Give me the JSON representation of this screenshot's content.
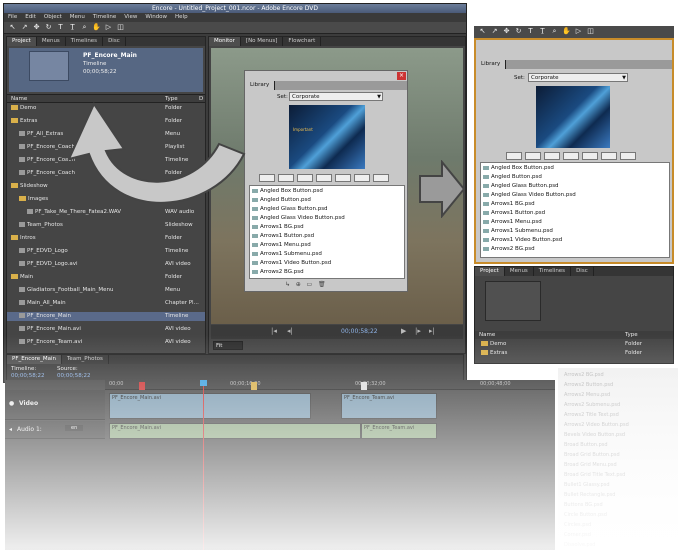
{
  "window": {
    "title": "Encore - Untitled_Project_001.ncor - Adobe Encore DVD"
  },
  "menu": [
    "File",
    "Edit",
    "Object",
    "Menu",
    "Timeline",
    "View",
    "Window",
    "Help"
  ],
  "tools": [
    "select-tool",
    "direct-select-tool",
    "move-tool",
    "rotate-tool",
    "text-tool",
    "vertical-text-tool",
    "zoom-tool",
    "hand-tool",
    "preview-tool",
    "edit-in-photoshop-tool"
  ],
  "project_panel": {
    "tabs": [
      "Project",
      "Menus",
      "Timelines",
      "Disc"
    ],
    "preview": {
      "name": "PF_Encore_Main",
      "kind": "Timeline",
      "duration": "00;00;58;22"
    },
    "columns": [
      "Name",
      "Type",
      "D"
    ],
    "items": [
      {
        "name": "Demo",
        "type": "Folder",
        "icon": "folder-icon"
      },
      {
        "name": "Extras",
        "type": "Folder",
        "icon": "folder-icon"
      },
      {
        "name": "PF_All_Extras",
        "type": "Menu",
        "icon": "file-icon"
      },
      {
        "name": "PF_Encore_Coach",
        "type": "Playlist",
        "icon": "file-icon"
      },
      {
        "name": "PF_Encore_Coach",
        "type": "Timeline",
        "icon": "file-icon"
      },
      {
        "name": "PF_Encore_Coach",
        "type": "Folder",
        "icon": "file-icon"
      },
      {
        "name": "Slideshow",
        "type": "Folder",
        "icon": "folder-icon"
      },
      {
        "name": "Images",
        "type": "Folder",
        "icon": "folder-icon"
      },
      {
        "name": "PF_Take_Me_There_Fatea2.WAV",
        "type": "WAV audio",
        "icon": "file-icon"
      },
      {
        "name": "Team_Photos",
        "type": "Slideshow",
        "icon": "file-icon"
      },
      {
        "name": "Intros",
        "type": "Folder",
        "icon": "folder-icon"
      },
      {
        "name": "PF_EDVD_Logo",
        "type": "Timeline",
        "icon": "file-icon"
      },
      {
        "name": "PF_EDVD_Logo.avi",
        "type": "AVI video",
        "icon": "file-icon"
      },
      {
        "name": "Main",
        "type": "Folder",
        "icon": "folder-icon"
      },
      {
        "name": "Gladiators_Football_Main_Menu",
        "type": "Menu",
        "icon": "file-icon"
      },
      {
        "name": "Main_All_Main",
        "type": "Chapter Pl...",
        "icon": "file-icon"
      },
      {
        "name": "PF_Encore_Main",
        "type": "Timeline",
        "icon": "file-icon"
      },
      {
        "name": "PF_Encore_Main.avi",
        "type": "AVI video",
        "icon": "file-icon"
      },
      {
        "name": "PF_Encore_Team.avi",
        "type": "AVI video",
        "icon": "file-icon"
      }
    ]
  },
  "monitor": {
    "tabs": [
      "Monitor",
      "[No Menus]",
      "Flowchart"
    ],
    "timecode": "00;00;58;22",
    "zoom": "Fit"
  },
  "library_floating": {
    "tab": "Library",
    "sort_label": "Set:",
    "sort_value": "Corporate",
    "thumb_text": "Important",
    "items": [
      "Angled Box Button.psd",
      "Angled Button.psd",
      "Angled Glass Button.psd",
      "Angled Glass Video Button.psd",
      "Arrows1 BG.psd",
      "Arrows1 Button.psd",
      "Arrows1 Menu.psd",
      "Arrows1 Submenu.psd",
      "Arrows1 Video Button.psd",
      "Arrows2 BG.psd"
    ]
  },
  "library_docked": {
    "tab": "Library",
    "sort_label": "Set:",
    "sort_value": "Corporate",
    "items": [
      "Angled Box Button.psd",
      "Angled Button.psd",
      "Angled Glass Button.psd",
      "Angled Glass Video Button.psd",
      "Arrows1 BG.psd",
      "Arrows1 Button.psd",
      "Arrows1 Menu.psd",
      "Arrows1 Submenu.psd",
      "Arrows1 Video Button.psd",
      "Arrows2 BG.psd"
    ]
  },
  "project_mini": {
    "tabs": [
      "Project",
      "Menus",
      "Timelines",
      "Disc"
    ],
    "columns": [
      "Name",
      "Type"
    ],
    "items": [
      {
        "name": "Demo",
        "type": "Folder"
      },
      {
        "name": "Extras",
        "type": "Folder"
      }
    ]
  },
  "timeline": {
    "tabs": [
      "PF_Encore_Main",
      "Team_Photos"
    ],
    "timeline_label": "Timeline:",
    "timeline_tc": "00;00;58;22",
    "source_label": "Source:",
    "source_tc": "00;00;58;22",
    "ruler": [
      "00;00",
      "00;00;16;00",
      "00;00;32;00",
      "00;00;48;00"
    ],
    "video_track": "Video",
    "audio_track": "Audio 1:",
    "audio_lang": "en",
    "video_clips": [
      "PF_Encore_Main.avi",
      "PF_Encore_Team.avi"
    ],
    "audio_clips": [
      "PF_Encore_Main.avi",
      "PF_Encore_Team.avi"
    ]
  },
  "ghost_list": [
    "Arrows2 BG.psd",
    "Arrows2 Button.psd",
    "Arrows2 Menu.psd",
    "Arrows2 Submenu.psd",
    "Arrows2 Title Text.psd",
    "Arrows2 Video Button.psd",
    "Bevels Video Button.psd",
    "Broad Button.psd",
    "Broad Grid Button.psd",
    "Broad Grid Menu.psd",
    "Broad Grid Title Text.psd",
    "Bullet1 Glassy.psd",
    "Bullet Rectangle.psd",
    "Buttons BG.psd",
    "Circle Button.psd",
    "Circles.psd",
    "Corner.psd",
    "Dissolve.psd"
  ],
  "colors": {
    "app_bg": "#3c3c3c",
    "panel": "#454545",
    "selection": "#5a6a8a",
    "folder": "#d9b04a",
    "playhead": "#3aa0e0"
  }
}
